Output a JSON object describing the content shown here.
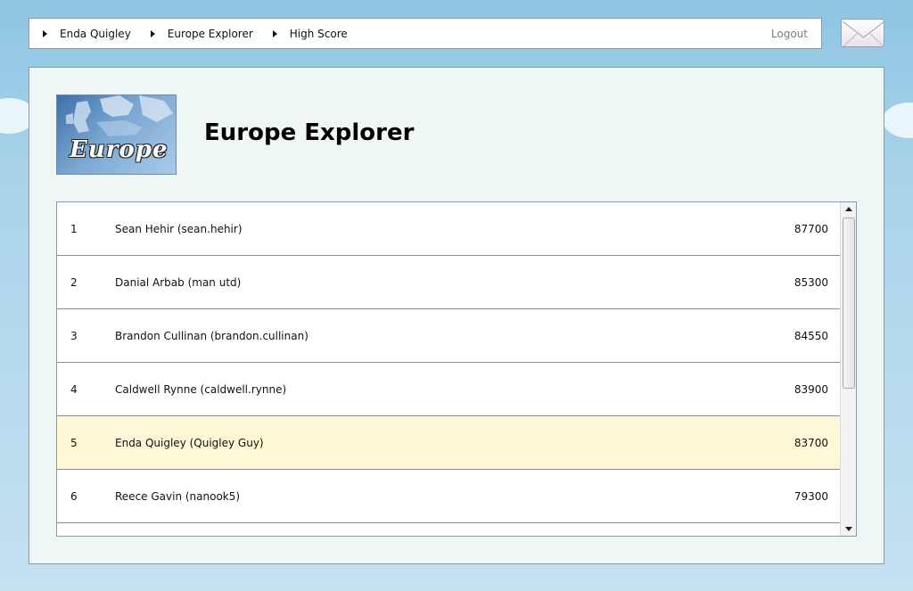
{
  "breadcrumb": [
    {
      "label": "Enda Quigley"
    },
    {
      "label": "Europe Explorer"
    },
    {
      "label": "High Score"
    }
  ],
  "logout_label": "Logout",
  "page": {
    "title": "Europe Explorer",
    "logo_text": "Europe"
  },
  "scores": [
    {
      "rank": "1",
      "name": "Sean Hehir (sean.hehir)",
      "score": "87700"
    },
    {
      "rank": "2",
      "name": "Danial Arbab (man utd)",
      "score": "85300"
    },
    {
      "rank": "3",
      "name": "Brandon Cullinan (brandon.cullinan)",
      "score": "84550"
    },
    {
      "rank": "4",
      "name": "Caldwell Rynne (caldwell.rynne)",
      "score": "83900"
    },
    {
      "rank": "5",
      "name": "Enda Quigley (Quigley Guy)",
      "score": "83700"
    },
    {
      "rank": "6",
      "name": "Reece Gavin (nanook5)",
      "score": "79300"
    },
    {
      "rank": "",
      "name": "",
      "score": ""
    }
  ],
  "icons": {
    "breadcrumb_separator": "triangle-right-icon",
    "mail": "mail-envelope-icon",
    "scroll_up": "chevron-up-icon",
    "scroll_down": "chevron-down-icon"
  },
  "colors": {
    "highlight_row": "#fff8d6",
    "panel_bg": "#eef6f6",
    "sky": "#8ec5e2"
  }
}
